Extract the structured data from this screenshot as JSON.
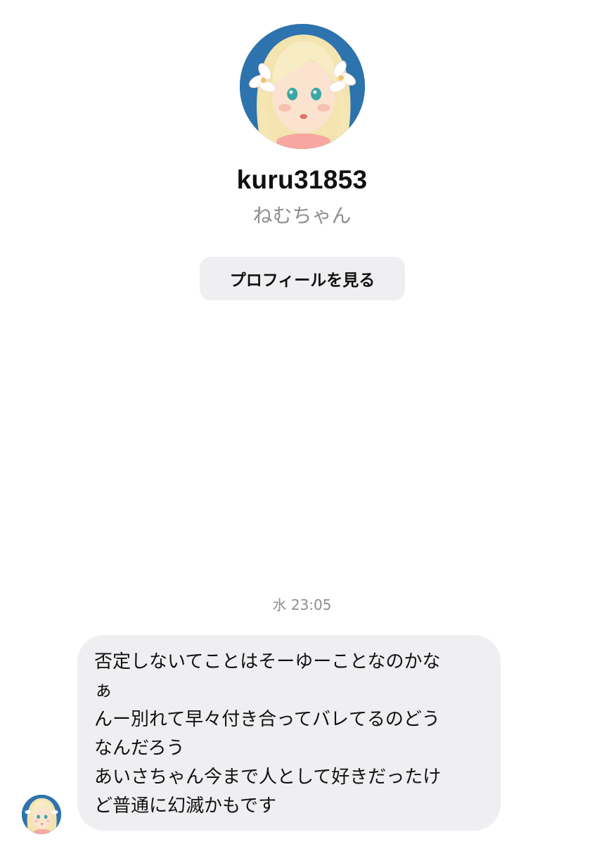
{
  "profile": {
    "username": "kuru31853",
    "display_name": "ねむちゃん",
    "view_profile_label": "プロフィールを見る"
  },
  "thread": {
    "timestamp": "水 23:05",
    "message": {
      "lines": [
        "否定しないてことはそーゆーことなのかな",
        "ぁ",
        "んー別れて早々付き合ってバレてるのどう",
        "なんだろう",
        "あいさちゃん今まで人として好きだったけ",
        "ど普通に幻滅かもです"
      ]
    }
  },
  "icons": {
    "profile_avatar": "avatar-icon",
    "sender_avatar": "avatar-icon"
  },
  "colors": {
    "background": "#ffffff",
    "bubble": "#efeff2",
    "button": "#efeff2",
    "secondary_text": "#8e8e8e",
    "primary_text": "#111111"
  }
}
